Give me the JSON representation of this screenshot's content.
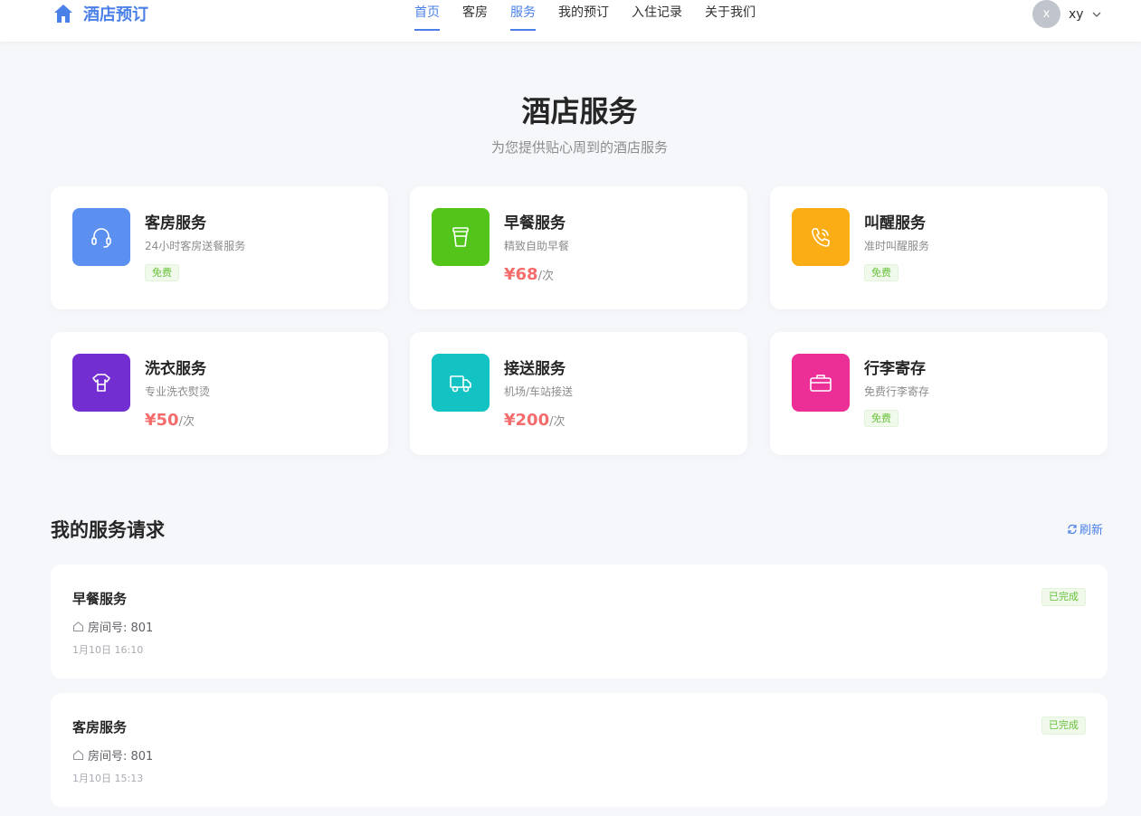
{
  "header": {
    "logo_text": "酒店预订",
    "nav": [
      "首页",
      "客房",
      "服务",
      "我的预订",
      "入住记录",
      "关于我们"
    ],
    "avatar_letter": "x",
    "user_name": "xy"
  },
  "hero": {
    "title": "酒店服务",
    "subtitle": "为您提供贴心周到的酒店服务"
  },
  "services": [
    {
      "name": "客房服务",
      "desc": "24小时客房送餐服务",
      "tag": "免费",
      "color": "#5b8ff0",
      "icon": "headset-icon"
    },
    {
      "name": "早餐服务",
      "desc": "精致自助早餐",
      "price": "¥68",
      "unit": "/次",
      "color": "#52c41a",
      "icon": "cup-icon"
    },
    {
      "name": "叫醒服务",
      "desc": "准时叫醒服务",
      "tag": "免费",
      "color": "#faad14",
      "icon": "phone-icon"
    },
    {
      "name": "洗衣服务",
      "desc": "专业洗衣熨烫",
      "price": "¥50",
      "unit": "/次",
      "color": "#722ed1",
      "icon": "laundry-icon"
    },
    {
      "name": "接送服务",
      "desc": "机场/车站接送",
      "price": "¥200",
      "unit": "/次",
      "color": "#13c2c2",
      "icon": "truck-icon"
    },
    {
      "name": "行李寄存",
      "desc": "免费行李寄存",
      "tag": "免费",
      "color": "#eb2f96",
      "icon": "suitcase-icon"
    }
  ],
  "requests_section": {
    "title": "我的服务请求",
    "refresh_label": "刷新"
  },
  "requests": [
    {
      "name": "早餐服务",
      "room": "房间号: 801",
      "time": "1月10日 16:10",
      "status": "已完成"
    },
    {
      "name": "客房服务",
      "room": "房间号: 801",
      "time": "1月10日 15:13",
      "status": "已完成"
    }
  ]
}
